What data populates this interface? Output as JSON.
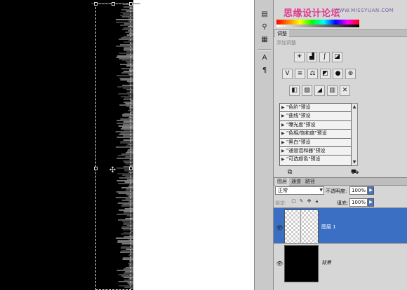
{
  "watermark": {
    "text": "思缘设计论坛",
    "site": "WWW.MISSYUAN.COM"
  },
  "adjustments": {
    "tab_label": "调整",
    "subtitle": "添加调整",
    "icon_rows": [
      [
        "brightness-contrast-icon",
        "levels-icon",
        "curves-icon",
        "exposure-icon"
      ],
      [
        "vibrance-icon",
        "hue-saturation-icon",
        "color-balance-icon",
        "black-white-icon",
        "photo-filter-icon",
        "channel-mixer-icon"
      ],
      [
        "invert-icon",
        "posterize-icon",
        "threshold-icon",
        "gradient-map-icon",
        "selective-color-icon"
      ]
    ],
    "presets": [
      "\"色阶\"预设",
      "\"曲线\"预设",
      "\"曝光度\"预设",
      "\"色相/饱和度\"预设",
      "\"黑白\"预设",
      "\"通道混和器\"预设",
      "\"可选颜色\"预设"
    ]
  },
  "layers_panel": {
    "tabs": [
      "图层",
      "通道",
      "路径"
    ],
    "blend_mode": "正常",
    "opacity_label": "不透明度:",
    "opacity_value": "100%",
    "lock_label": "锁定:",
    "fill_label": "填充:",
    "fill_value": "100%",
    "layers": [
      {
        "name": "图层 1",
        "selected": true
      },
      {
        "name": "背景",
        "selected": false
      }
    ]
  },
  "colors": {
    "selection_blue": "#3a6fc4",
    "panel_bg": "#d6d6d6",
    "watermark_pink": "#e13a8e"
  }
}
